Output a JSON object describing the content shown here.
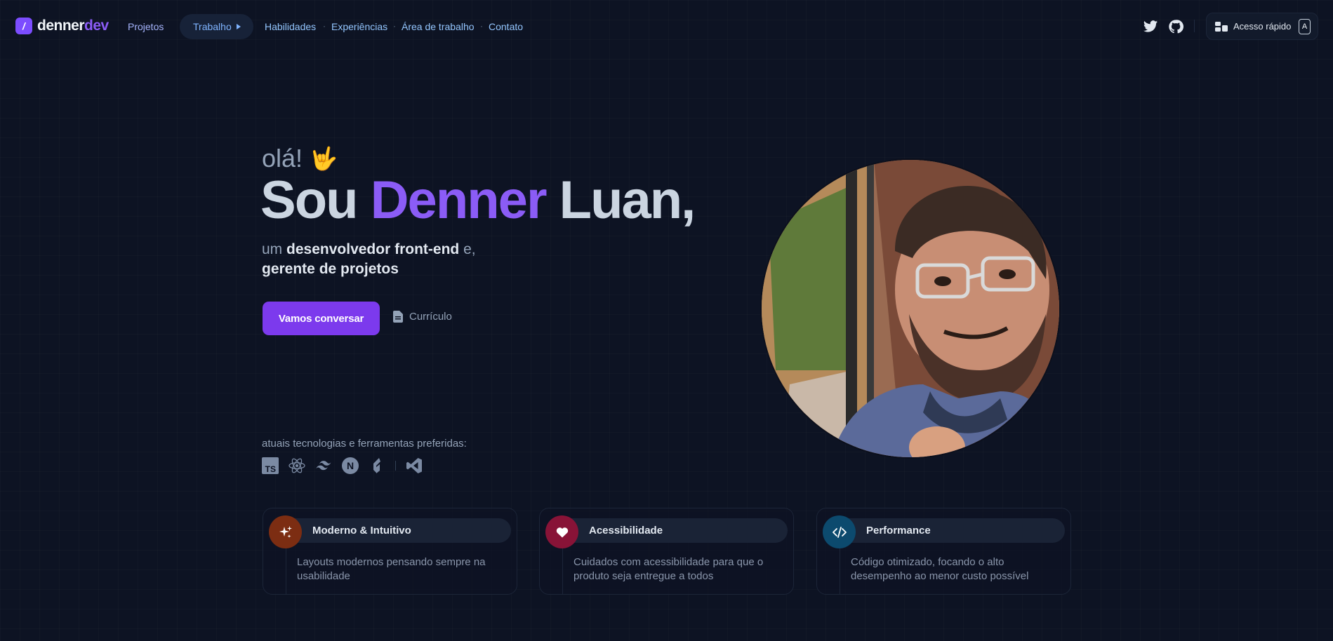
{
  "brand": {
    "mark": "/",
    "name_part1": "denner",
    "name_part2": "dev",
    "accent": "#8b5cf6"
  },
  "nav": {
    "projetos": "Projetos",
    "trabalho": "Trabalho",
    "habilidades": "Habilidades",
    "experiencias": "Experiências",
    "area": "Área de trabalho",
    "contato": "Contato",
    "separator": "·",
    "social_icons": [
      "twitter-icon",
      "github-icon"
    ],
    "quick_access": "Acesso rápido",
    "quick_key": "A"
  },
  "hero": {
    "greeting": "olá!",
    "greeting_emoji": "🤟",
    "title_word1": "Sou",
    "title_word2": "Denner",
    "title_word3": "Luan,",
    "sub_pre": "um",
    "sub_role1": "desenvolvedor front-end",
    "sub_mid": "e,",
    "sub_role2": "gerente de projetos",
    "cta_primary": "Vamos conversar",
    "cta_secondary": "Currículo",
    "tech_label": "atuais tecnologias e ferramentas preferidas:",
    "tech_icons": [
      "typescript-icon",
      "react-icon",
      "tailwind-icon",
      "nextjs-icon",
      "gatsby-icon",
      "vscode-icon"
    ],
    "tech_ts_badge": "TS",
    "tech_next_badge": "N"
  },
  "cards": [
    {
      "title": "Moderno & Intuitivo",
      "description": "Layouts modernos pensando sempre na usabilidade",
      "icon": "sparkles-icon",
      "color": "#7c2d12"
    },
    {
      "title": "Acessibilidade",
      "description": "Cuidados com acessibilidade para que o produto seja entregue a todos",
      "icon": "heart-icon",
      "color": "#881337"
    },
    {
      "title": "Performance",
      "description": "Código otimizado, focando o alto desempenho ao menor custo possível",
      "icon": "code-icon",
      "color": "#0c4a6e"
    }
  ]
}
